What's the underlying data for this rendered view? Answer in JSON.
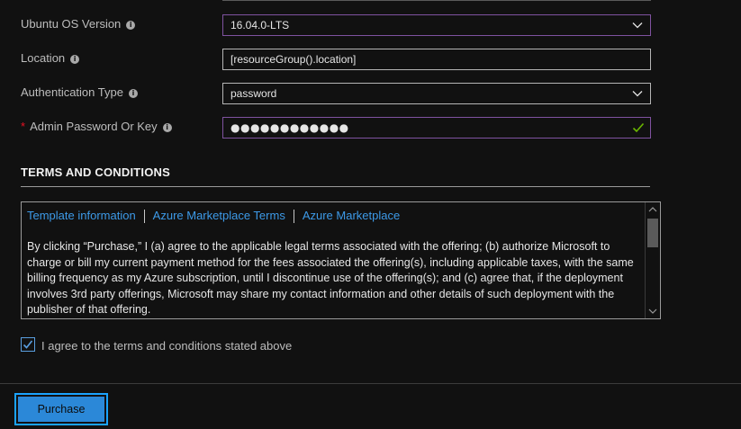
{
  "form": {
    "ubuntu_version": {
      "label": "Ubuntu OS Version",
      "value": "16.04.0-LTS"
    },
    "location": {
      "label": "Location",
      "value": "[resourceGroup().location]"
    },
    "auth_type": {
      "label": "Authentication Type",
      "value": "password"
    },
    "admin_password": {
      "required_marker": "*",
      "label": "Admin Password Or Key",
      "value": "●●●●●●●●●●●●"
    }
  },
  "terms": {
    "title": "TERMS AND CONDITIONS",
    "tabs": [
      "Template information",
      "Azure Marketplace Terms",
      "Azure Marketplace"
    ],
    "body": "By clicking “Purchase,” I (a) agree to the applicable legal terms associated with the offering; (b) authorize Microsoft to charge or bill my current payment method for the fees associated the offering(s), including applicable taxes, with the same billing frequency as my Azure subscription, until I discontinue use of the offering(s); and (c) agree that, if the deployment involves 3rd party offerings, Microsoft may share my contact information and other details of such deployment with the publisher of that offering.",
    "agree_label": "I agree to the terms and conditions stated above",
    "agree_checked": true
  },
  "footer": {
    "purchase_label": "Purchase"
  },
  "colors": {
    "accent": "#2b88d8",
    "focus_border": "#1aa3ff",
    "link": "#3d9ae8",
    "valid_check": "#6bb700",
    "select_border": "#7f52a0",
    "required": "#e81123"
  },
  "icons": {
    "info": "info-icon",
    "chevron": "chevron-down-icon",
    "check": "check-icon"
  }
}
